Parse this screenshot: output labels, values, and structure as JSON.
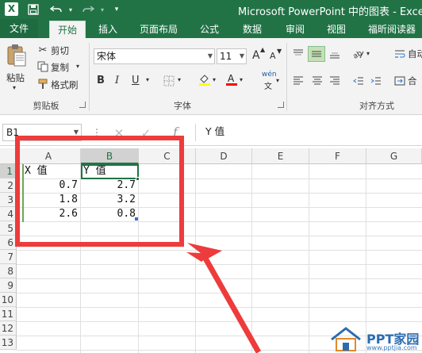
{
  "window": {
    "title": "Microsoft PowerPoint 中的图表 - Excel",
    "app_icon": "X"
  },
  "quick_access": {
    "save_icon": "save-icon",
    "undo_icon": "undo-icon",
    "redo_icon": "redo-icon",
    "customize_icon": "chevron-down-icon"
  },
  "tabs": [
    {
      "label": "文件"
    },
    {
      "label": "开始"
    },
    {
      "label": "插入"
    },
    {
      "label": "页面布局"
    },
    {
      "label": "公式"
    },
    {
      "label": "数据"
    },
    {
      "label": "审阅"
    },
    {
      "label": "视图"
    },
    {
      "label": "福昕阅读器"
    }
  ],
  "ribbon": {
    "clipboard": {
      "paste_label": "粘贴",
      "cut_label": "剪切",
      "copy_label": "复制",
      "format_painter_label": "格式刷",
      "group_label": "剪贴板"
    },
    "font": {
      "font_name": "宋体",
      "font_size": "11",
      "bold": "B",
      "italic": "I",
      "underline": "U",
      "phonetic": "wén",
      "phonetic_sub": "文",
      "grow": "A",
      "shrink": "A",
      "group_label": "字体",
      "fill_color": "#ffff00",
      "font_color": "#ff0000"
    },
    "alignment": {
      "wrap_label": "自动",
      "merge_label": "合",
      "group_label": "对齐方式"
    }
  },
  "formula_bar": {
    "name_box": "B1",
    "fx": "f",
    "value": "Y 值"
  },
  "sheet": {
    "columns": [
      "A",
      "B",
      "C",
      "D",
      "E",
      "F",
      "G"
    ],
    "rows": [
      "1",
      "2",
      "3",
      "4",
      "5",
      "6",
      "7",
      "8",
      "9",
      "10",
      "11",
      "12",
      "13"
    ],
    "selected_cell": "B1",
    "cells": {
      "A1": "X 值",
      "B1": "Y 值",
      "A2": "0.7",
      "B2": "2.7",
      "A3": "1.8",
      "B3": "3.2",
      "A4": "2.6",
      "B4": "0.8"
    }
  },
  "annotation": {
    "color": "#ee3b3b"
  },
  "watermark": {
    "text": "PPT家园",
    "url": "www.pptjia.com"
  }
}
